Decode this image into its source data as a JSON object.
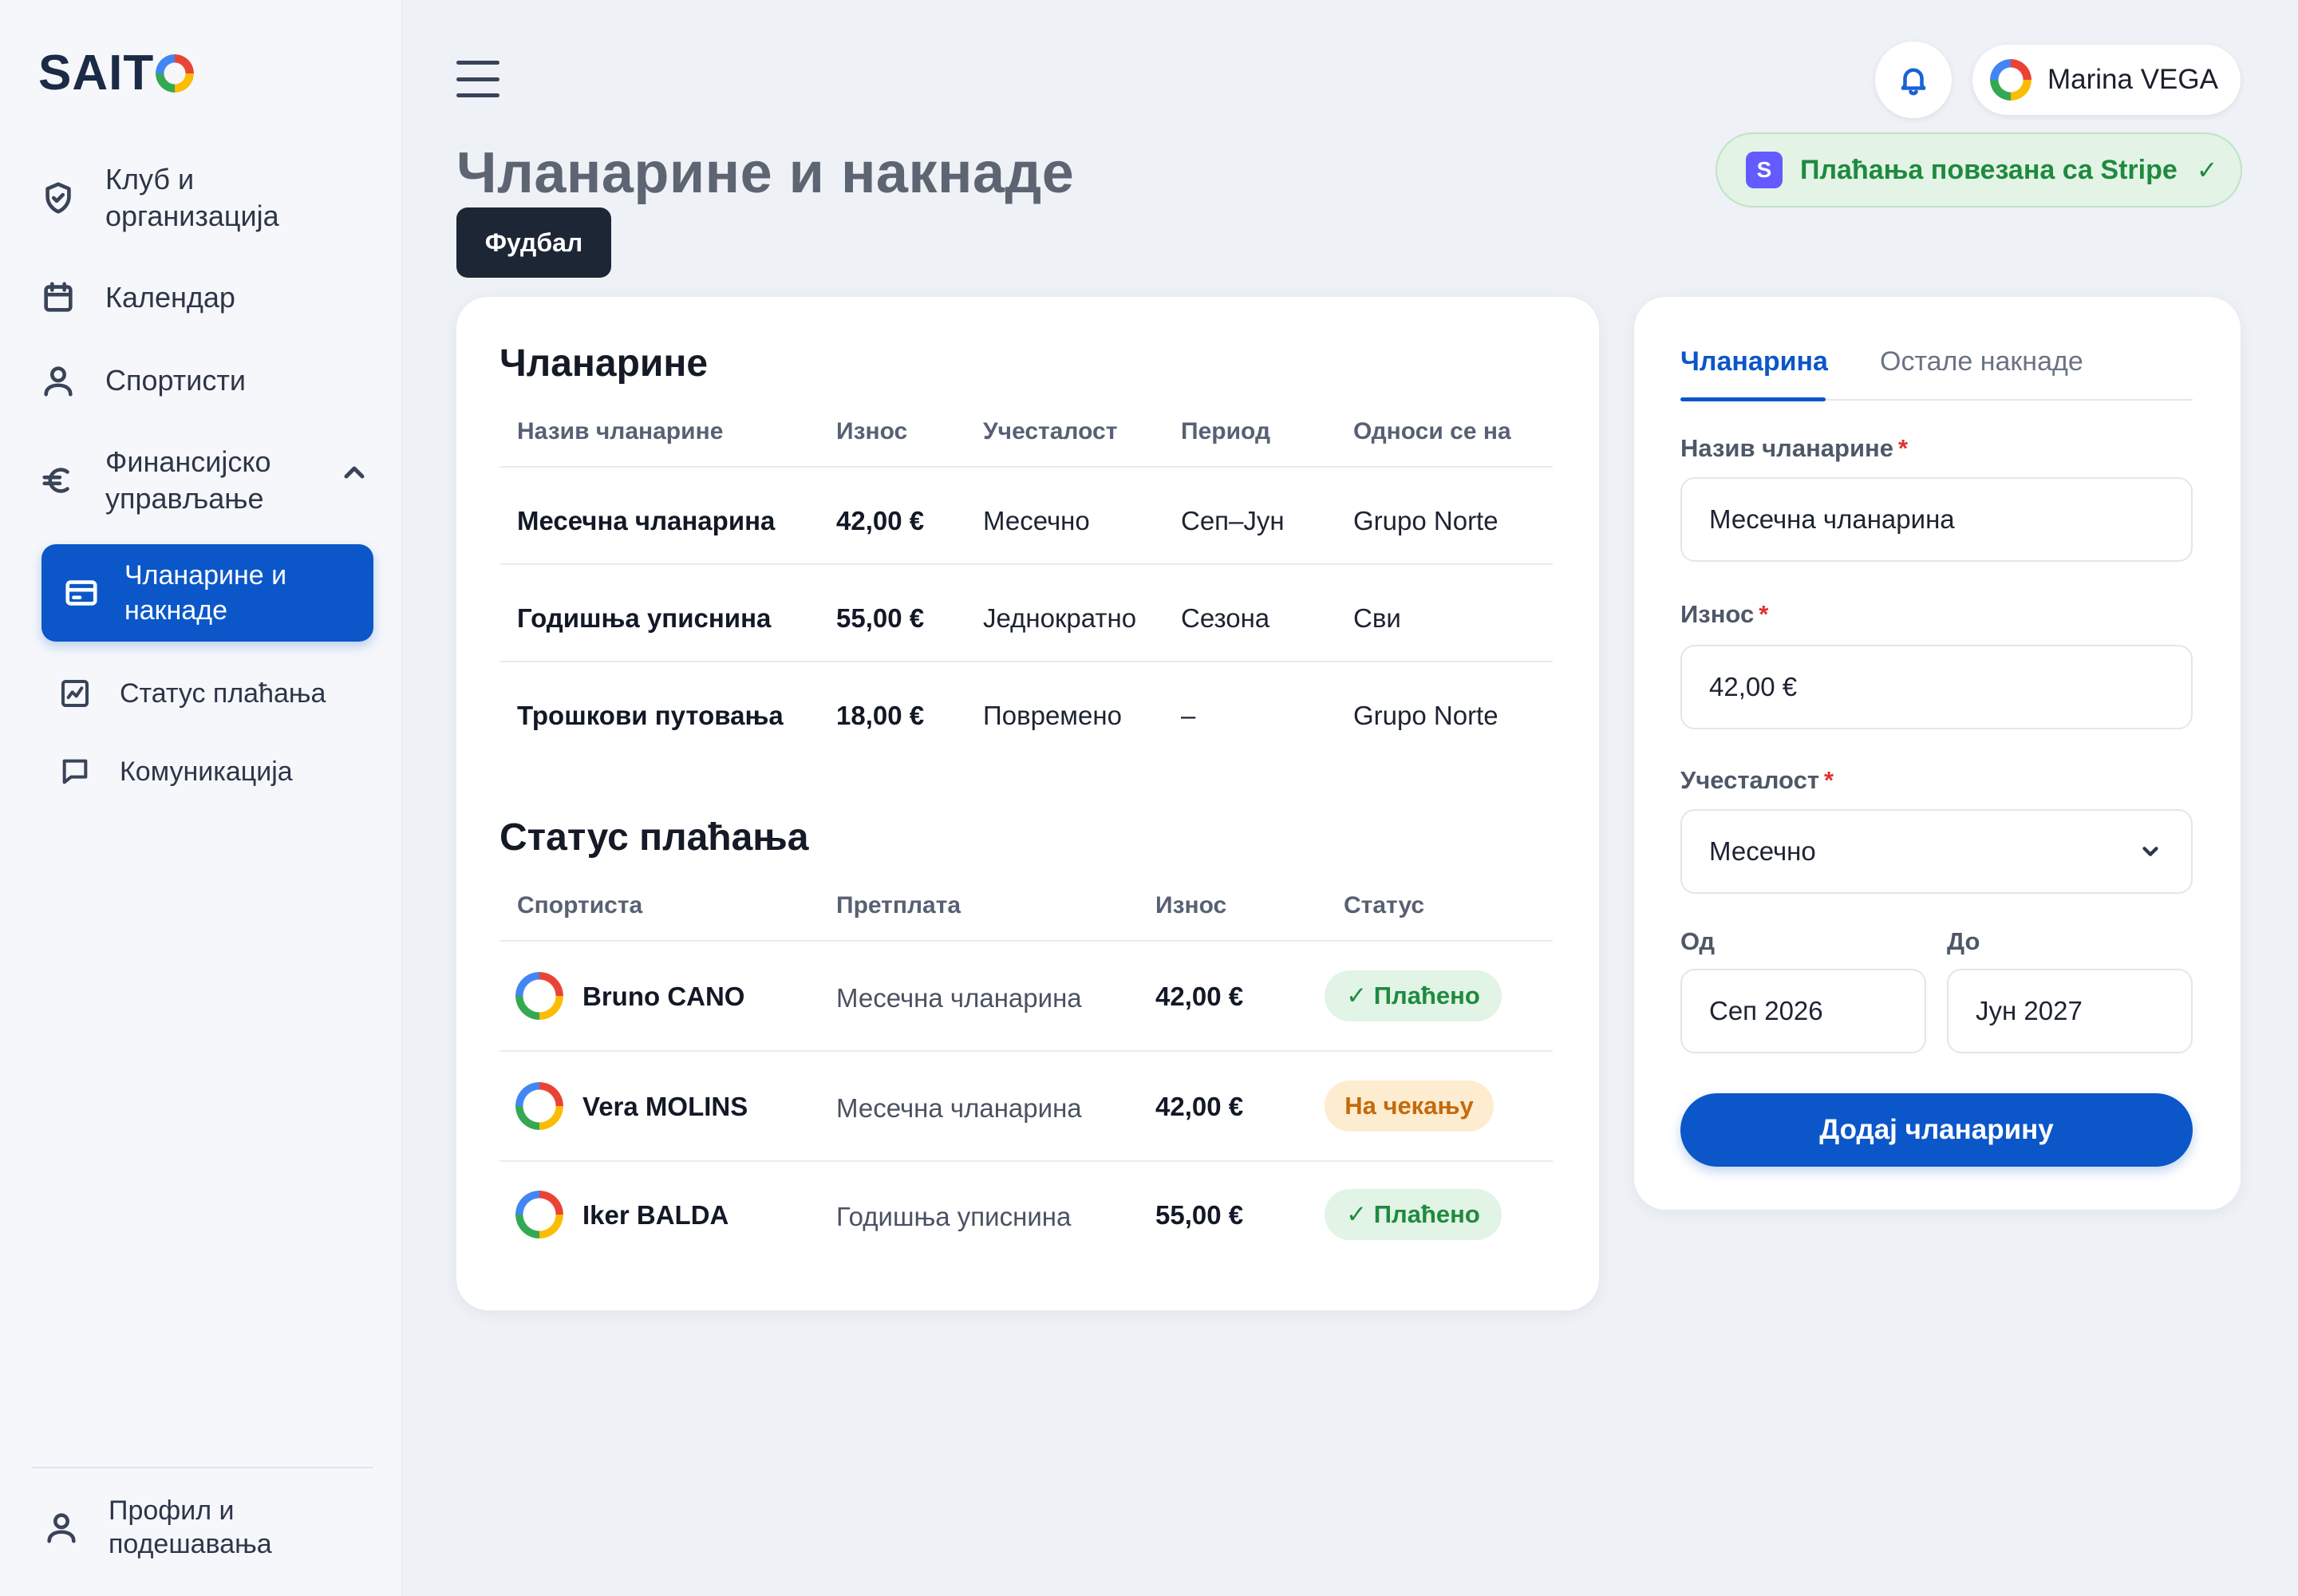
{
  "brand": {
    "logo_text": "SAIT"
  },
  "sidebar": {
    "items": [
      {
        "label_line1": "Клуб и",
        "label_line2": "организација",
        "icon": "shield-check-icon"
      },
      {
        "label": "Календар",
        "icon": "calendar-icon"
      },
      {
        "label": "Спортисти",
        "icon": "user-icon"
      },
      {
        "label_line1": "Финансијско",
        "label_line2": "управљање",
        "icon": "euro-icon",
        "expanded": true
      }
    ],
    "subitems": [
      {
        "label_line1": "Чланарине и",
        "label_line2": "накнаде",
        "icon": "card-icon",
        "active": true
      },
      {
        "label": "Статус плаћања",
        "icon": "chart-icon"
      },
      {
        "label": "Комуникација",
        "icon": "chat-icon"
      }
    ],
    "footer": {
      "label_line1": "Профил и",
      "label_line2": "подешавања",
      "icon": "user-icon"
    }
  },
  "header": {
    "user_name": "Marina VEGA",
    "page_title": "Чланарине и накнаде",
    "sport_filter": "Фудбал",
    "stripe": {
      "icon_letter": "S",
      "label": "Плаћања повезана са Stripe",
      "check": "✓"
    }
  },
  "memberships": {
    "title": "Чланарине",
    "columns": [
      "Назив чланарине",
      "Износ",
      "Учесталост",
      "Период",
      "Односи се на"
    ],
    "rows": [
      [
        "Месечна чланарина",
        "42,00 €",
        "Месечно",
        "Сеп–Јун",
        "Grupo Norte"
      ],
      [
        "Годишња уписнина",
        "55,00 €",
        "Једнократно",
        "Сезона",
        "Сви"
      ],
      [
        "Трошкови путовања",
        "18,00 €",
        "Повремено",
        "–",
        "Grupo Norte"
      ]
    ]
  },
  "payments": {
    "title": "Статус плаћања",
    "columns": [
      "Спортиста",
      "Претплата",
      "Износ",
      "Статус"
    ],
    "rows": [
      {
        "name": "Bruno CANO",
        "plan": "Месечна чланарина",
        "amount": "42,00 €",
        "status": "✓  Плаћено",
        "state": "paid"
      },
      {
        "name": "Vera MOLINS",
        "plan": "Месечна чланарина",
        "amount": "42,00 €",
        "status": "На чекању",
        "state": "pending"
      },
      {
        "name": "Iker BALDA",
        "plan": "Годишња уписнина",
        "amount": "55,00 €",
        "status": "✓  Плаћено",
        "state": "paid"
      }
    ]
  },
  "form": {
    "tabs": [
      "Чланарина",
      "Остале накнаде"
    ],
    "active_tab": 0,
    "name_label": "Назив чланарине",
    "name_value": "Месечна чланарина",
    "amount_label": "Износ",
    "amount_value": "42,00 €",
    "frequency_label": "Учесталост",
    "frequency_value": "Месечно",
    "from_label": "Од",
    "from_value": "Сеп 2026",
    "to_label": "До",
    "to_value": "Јун 2027",
    "required_mark": "*",
    "submit_label": "Додај чланарину"
  },
  "colors": {
    "primary": "#0b57c9",
    "paid_bg": "#e1f4e5",
    "paid_text": "#1f8a3f",
    "pending_bg": "#fdeccf",
    "pending_text": "#c46a0b",
    "stripe": "#635bff"
  }
}
